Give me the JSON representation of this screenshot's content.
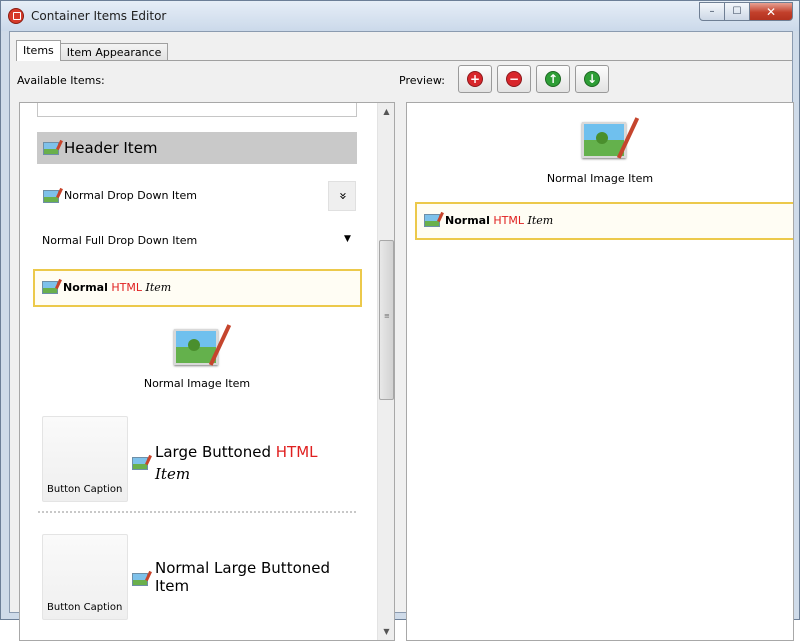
{
  "window": {
    "title": "Container Items Editor",
    "minimize": "–",
    "maximize": "☐",
    "close": "✕"
  },
  "tabs": [
    {
      "label": "Items"
    },
    {
      "label": "Item Appearance"
    }
  ],
  "labels": {
    "available": "Available Items:",
    "preview": "Preview:"
  },
  "toolbar": {
    "buttons": [
      {
        "name": "add",
        "glyph": "+",
        "color": "#d8262b"
      },
      {
        "name": "remove",
        "glyph": "−",
        "color": "#d8262b"
      },
      {
        "name": "move-up",
        "glyph": "↑",
        "color": "#2e9e36"
      },
      {
        "name": "move-down",
        "glyph": "↓",
        "color": "#2e9e36"
      }
    ]
  },
  "available_items": {
    "header_item": "Header Item",
    "drop_down_item": "Normal Drop Down Item",
    "drop_down_arrow": "»",
    "full_drop_down_item": "Normal Full Drop Down Item",
    "full_drop_down_arrow": "▼",
    "html_item": {
      "bold": "Normal",
      "red": "HTML",
      "italic": "Item"
    },
    "image_item": "Normal Image Item",
    "large_buttoned_html": {
      "line1": "Large Buttoned",
      "red": "HTML",
      "line2": "Item",
      "caption": "Button Caption"
    },
    "normal_large_buttoned": {
      "line1": "Normal Large Buttoned",
      "line2": "Item",
      "caption": "Button Caption"
    }
  },
  "preview_items": {
    "image_item": "Normal Image Item",
    "html_item": {
      "bold": "Normal",
      "red": "HTML",
      "italic": "Item"
    }
  },
  "colors": {
    "selection_border": "#ecc94b",
    "header_bg": "#c9c9c9",
    "html_red": "#e02020"
  }
}
